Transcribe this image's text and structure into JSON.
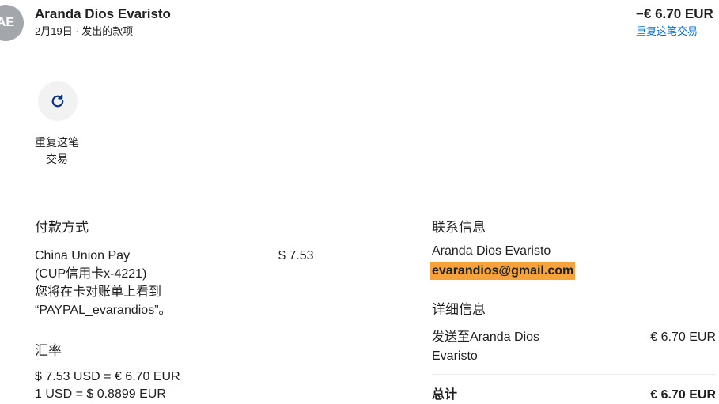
{
  "colors": {
    "text": "#1f1f1f",
    "link": "#0070e0",
    "email_highlight": "#f6a33c",
    "avatar_bg": "#a3a7ab",
    "icon": "#003087",
    "divider": "#ebebeb"
  },
  "header": {
    "avatar_initials": "AE",
    "name": "Aranda Dios Evaristo",
    "subtitle": "2月19日 · 发出的款项",
    "amount": "−€ 6.70 EUR",
    "repeat_link": "重复这笔交易"
  },
  "actions": {
    "repeat": {
      "icon": "refresh-icon",
      "label_lines": [
        "重复这笔",
        "交易"
      ]
    }
  },
  "payment_method": {
    "heading": "付款方式",
    "lines": [
      "China Union Pay",
      "(CUP信用卡x-4221)",
      "您将在卡对账单上看到",
      "“PAYPAL_evarandios”。"
    ],
    "amount": "$ 7.53"
  },
  "exchange_rate": {
    "heading": "汇率",
    "lines": [
      "$ 7.53 USD = € 6.70 EUR",
      "1 USD = $ 0.8899 EUR"
    ]
  },
  "contact_info": {
    "heading": "联系信息",
    "name": "Aranda Dios Evaristo",
    "email": "evarandios@gmail.com"
  },
  "details": {
    "heading": "详细信息",
    "sent_to_lines": [
      "发送至Aranda Dios",
      "Evaristo"
    ],
    "sent_amount": "€ 6.70 EUR",
    "total_label": "总计",
    "total_amount": "€ 6.70 EUR"
  }
}
